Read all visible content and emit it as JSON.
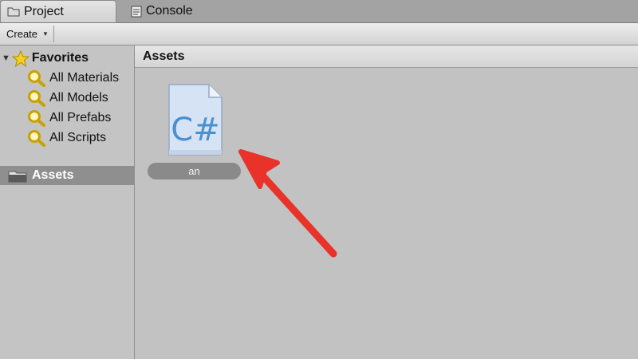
{
  "tabs": [
    {
      "label": "Project",
      "icon": "folder-icon",
      "active": true
    },
    {
      "label": "Console",
      "icon": "console-icon",
      "active": false
    }
  ],
  "toolbar": {
    "create_label": "Create"
  },
  "sidebar": {
    "favorites_label": "Favorites",
    "favorites": [
      {
        "label": "All Materials",
        "icon": "search-icon"
      },
      {
        "label": "All Models",
        "icon": "search-icon"
      },
      {
        "label": "All Prefabs",
        "icon": "search-icon"
      },
      {
        "label": "All Scripts",
        "icon": "search-icon"
      }
    ],
    "assets_label": "Assets"
  },
  "main": {
    "breadcrumb": "Assets",
    "files": [
      {
        "name": "an",
        "type_text": "C#",
        "icon": "csharp-script-icon"
      }
    ]
  },
  "colors": {
    "arrow": "#e8322a",
    "selected_row": "#8f8f8f",
    "icon_blue": "#4a8fd0"
  }
}
